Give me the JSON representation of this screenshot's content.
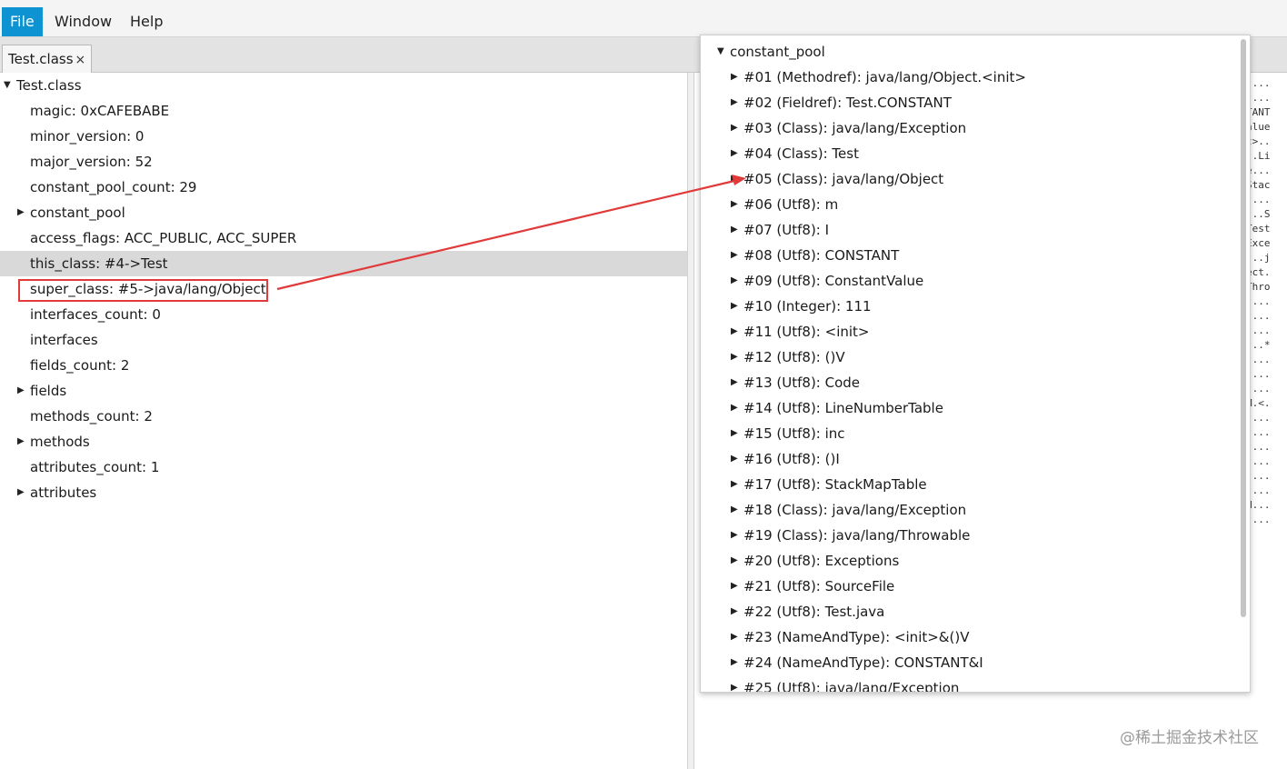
{
  "menubar": {
    "items": [
      {
        "label": "File",
        "active": true
      },
      {
        "label": "Window",
        "active": false
      },
      {
        "label": "Help",
        "active": false
      }
    ]
  },
  "tabs": [
    {
      "label": "Test.class",
      "close": "×"
    }
  ],
  "tree": {
    "root": "Test.class",
    "items": [
      {
        "label": "magic: 0xCAFEBABE",
        "expandable": false
      },
      {
        "label": "minor_version: 0",
        "expandable": false
      },
      {
        "label": "major_version: 52",
        "expandable": false
      },
      {
        "label": "constant_pool_count: 29",
        "expandable": false
      },
      {
        "label": "constant_pool",
        "expandable": true
      },
      {
        "label": "access_flags: ACC_PUBLIC, ACC_SUPER",
        "expandable": false
      },
      {
        "label": "this_class: #4->Test",
        "expandable": false,
        "selected": true
      },
      {
        "label": "super_class: #5->java/lang/Object",
        "expandable": false,
        "highlighted": true
      },
      {
        "label": "interfaces_count: 0",
        "expandable": false
      },
      {
        "label": "interfaces",
        "expandable": false
      },
      {
        "label": "fields_count: 2",
        "expandable": false
      },
      {
        "label": "fields",
        "expandable": true
      },
      {
        "label": "methods_count: 2",
        "expandable": false
      },
      {
        "label": "methods",
        "expandable": true
      },
      {
        "label": "attributes_count: 1",
        "expandable": false
      },
      {
        "label": "attributes",
        "expandable": true
      }
    ]
  },
  "popup": {
    "root": "constant_pool",
    "entries": [
      "#01 (Methodref): java/lang/Object.<init>",
      "#02 (Fieldref): Test.CONSTANT",
      "#03 (Class): java/lang/Exception",
      "#04 (Class): Test",
      "#05 (Class): java/lang/Object",
      "#06 (Utf8): m",
      "#07 (Utf8): I",
      "#08 (Utf8): CONSTANT",
      "#09 (Utf8): ConstantValue",
      "#10 (Integer): 111",
      "#11 (Utf8): <init>",
      "#12 (Utf8): ()V",
      "#13 (Utf8): Code",
      "#14 (Utf8): LineNumberTable",
      "#15 (Utf8): inc",
      "#16 (Utf8): ()I",
      "#17 (Utf8): StackMapTable",
      "#18 (Class): java/lang/Exception",
      "#19 (Class): java/lang/Throwable",
      "#20 (Utf8): Exceptions",
      "#21 (Utf8): SourceFile",
      "#22 (Utf8): Test.java",
      "#23 (NameAndType): <init>&()V",
      "#24 (NameAndType): CONSTANT&I",
      "#25 (Utf8): java/lang/Exception"
    ]
  },
  "hex_column": [
    "....",
    "....",
    "TANT",
    "alue",
    "t>..",
    "..Li",
    "e...",
    "Stac",
    "....",
    "...S",
    "Test",
    "Exce",
    "...j",
    "ect.",
    "Thro",
    "....",
    "....",
    "....",
    "...*",
    "....",
    "....",
    "....",
    "M.<.",
    "....",
    "....",
    "....",
    "....",
    "....",
    "....",
    "H...",
    "...."
  ],
  "watermark": "@稀土掘金技术社区",
  "colors": {
    "menu_active": "#0d93d2",
    "selection": "#d9d9d9",
    "annotation_red": "#e03a3a"
  }
}
